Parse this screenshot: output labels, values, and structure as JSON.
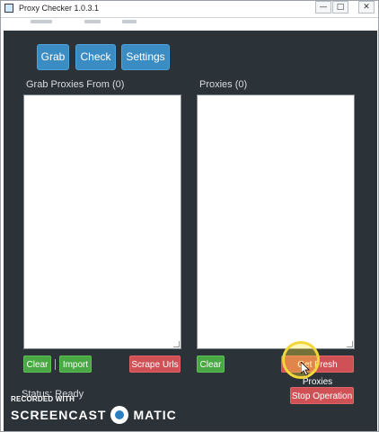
{
  "window": {
    "title": "Proxy Checker 1.0.3.1",
    "controls": {
      "minimize": "—",
      "maximize": "□",
      "close": "✕"
    }
  },
  "nav": {
    "grab": "Grab",
    "check": "Check",
    "settings": "Settings",
    "accent": "#3a8cc3"
  },
  "left_panel": {
    "label": "Grab Proxies From (0)",
    "value": "",
    "buttons": {
      "clear": "Clear",
      "separator": "|",
      "import": "Import",
      "scrape": "Scrape Urls"
    }
  },
  "right_panel": {
    "label": "Proxies (0)",
    "value": "",
    "buttons": {
      "clear": "Clear",
      "get_fresh": "Get Fresh Proxies",
      "stop": "Stop Operation"
    }
  },
  "status": {
    "text": "Status: Ready"
  },
  "colors": {
    "green": "#49a843",
    "red": "#cf5055",
    "background": "#2b3238"
  },
  "watermark": {
    "recorded_with": "RECORDED WITH",
    "brand_left": "SCREENCAST",
    "brand_right": "MATIC"
  }
}
